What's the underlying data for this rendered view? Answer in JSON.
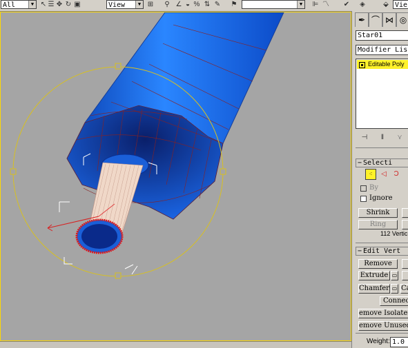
{
  "toolbar": {
    "selection_filter": "All",
    "reference_coord": "View",
    "viewport_label": "Vie"
  },
  "command_panel": {
    "object_name": "Star01",
    "modifier_list_label": "Modifier List",
    "stack_items": [
      "Editable Poly"
    ],
    "selection": {
      "title": "Selecti",
      "by_label": "By",
      "ignore_label": "Ignore",
      "shrink_label": "Shrink",
      "ring_label": "Ring",
      "count_label": "112 Vertic"
    },
    "edit_vertices": {
      "title": "Edit Vert",
      "remove_label": "Remove",
      "extrude_label": "Extrude",
      "chamfer_label": "Chamfer",
      "ca_label": "Ca",
      "connect_label": "Connec",
      "remove_isolated_label": "emove Isolate",
      "remove_unused_label": "emove Unused",
      "weight_label": "Weight:",
      "weight_value": "1.0"
    }
  },
  "colors": {
    "viewport_bg": "#a5a5a5",
    "mesh_blue": "#1a6fe8",
    "gizmo_yellow": "#d8c020",
    "selected_red": "#e01818",
    "stack_highlight": "#fff22a"
  }
}
